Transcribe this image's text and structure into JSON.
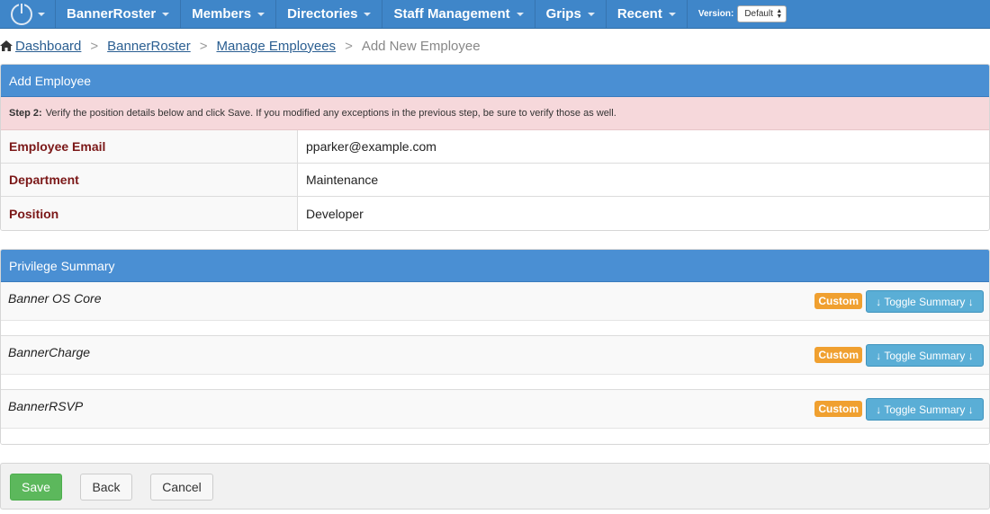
{
  "nav": {
    "items": [
      {
        "label": "BannerRoster"
      },
      {
        "label": "Members"
      },
      {
        "label": "Directories"
      },
      {
        "label": "Staff Management"
      },
      {
        "label": "Grips"
      },
      {
        "label": "Recent"
      }
    ],
    "version_label": "Version:",
    "version_value": "Default"
  },
  "breadcrumb": {
    "items": [
      "Dashboard",
      "BannerRoster",
      "Manage Employees"
    ],
    "separator": ">",
    "current": "Add New Employee"
  },
  "employee_panel": {
    "title": "Add Employee",
    "alert_strong": "Step 2:",
    "alert_text": "Verify the position details below and click Save. If you modified any exceptions in the previous step, be sure to verify those as well.",
    "rows": [
      {
        "label": "Employee Email",
        "value": "pparker@example.com"
      },
      {
        "label": "Department",
        "value": "Maintenance"
      },
      {
        "label": "Position",
        "value": "Developer"
      }
    ]
  },
  "privilege_panel": {
    "title": "Privilege Summary",
    "rows": [
      {
        "name": "Banner OS Core",
        "badge": "Custom",
        "toggle_label": "↓ Toggle Summary ↓"
      },
      {
        "name": "BannerCharge",
        "badge": "Custom",
        "toggle_label": "↓ Toggle Summary ↓"
      },
      {
        "name": "BannerRSVP",
        "badge": "Custom",
        "toggle_label": "↓ Toggle Summary ↓"
      }
    ]
  },
  "footer": {
    "save_label": "Save",
    "back_label": "Back",
    "cancel_label": "Cancel"
  },
  "colors": {
    "nav_bg": "#3f86c9",
    "panel_header": "#4a8fd3",
    "alert_bg": "#f6d8db",
    "label_text": "#7b1818",
    "badge_custom": "#f0a030",
    "toggle_button": "#5aaed6",
    "save_button": "#5cb85c"
  },
  "icons": {
    "logo": "power-icon",
    "breadcrumb_home": "home-icon"
  }
}
